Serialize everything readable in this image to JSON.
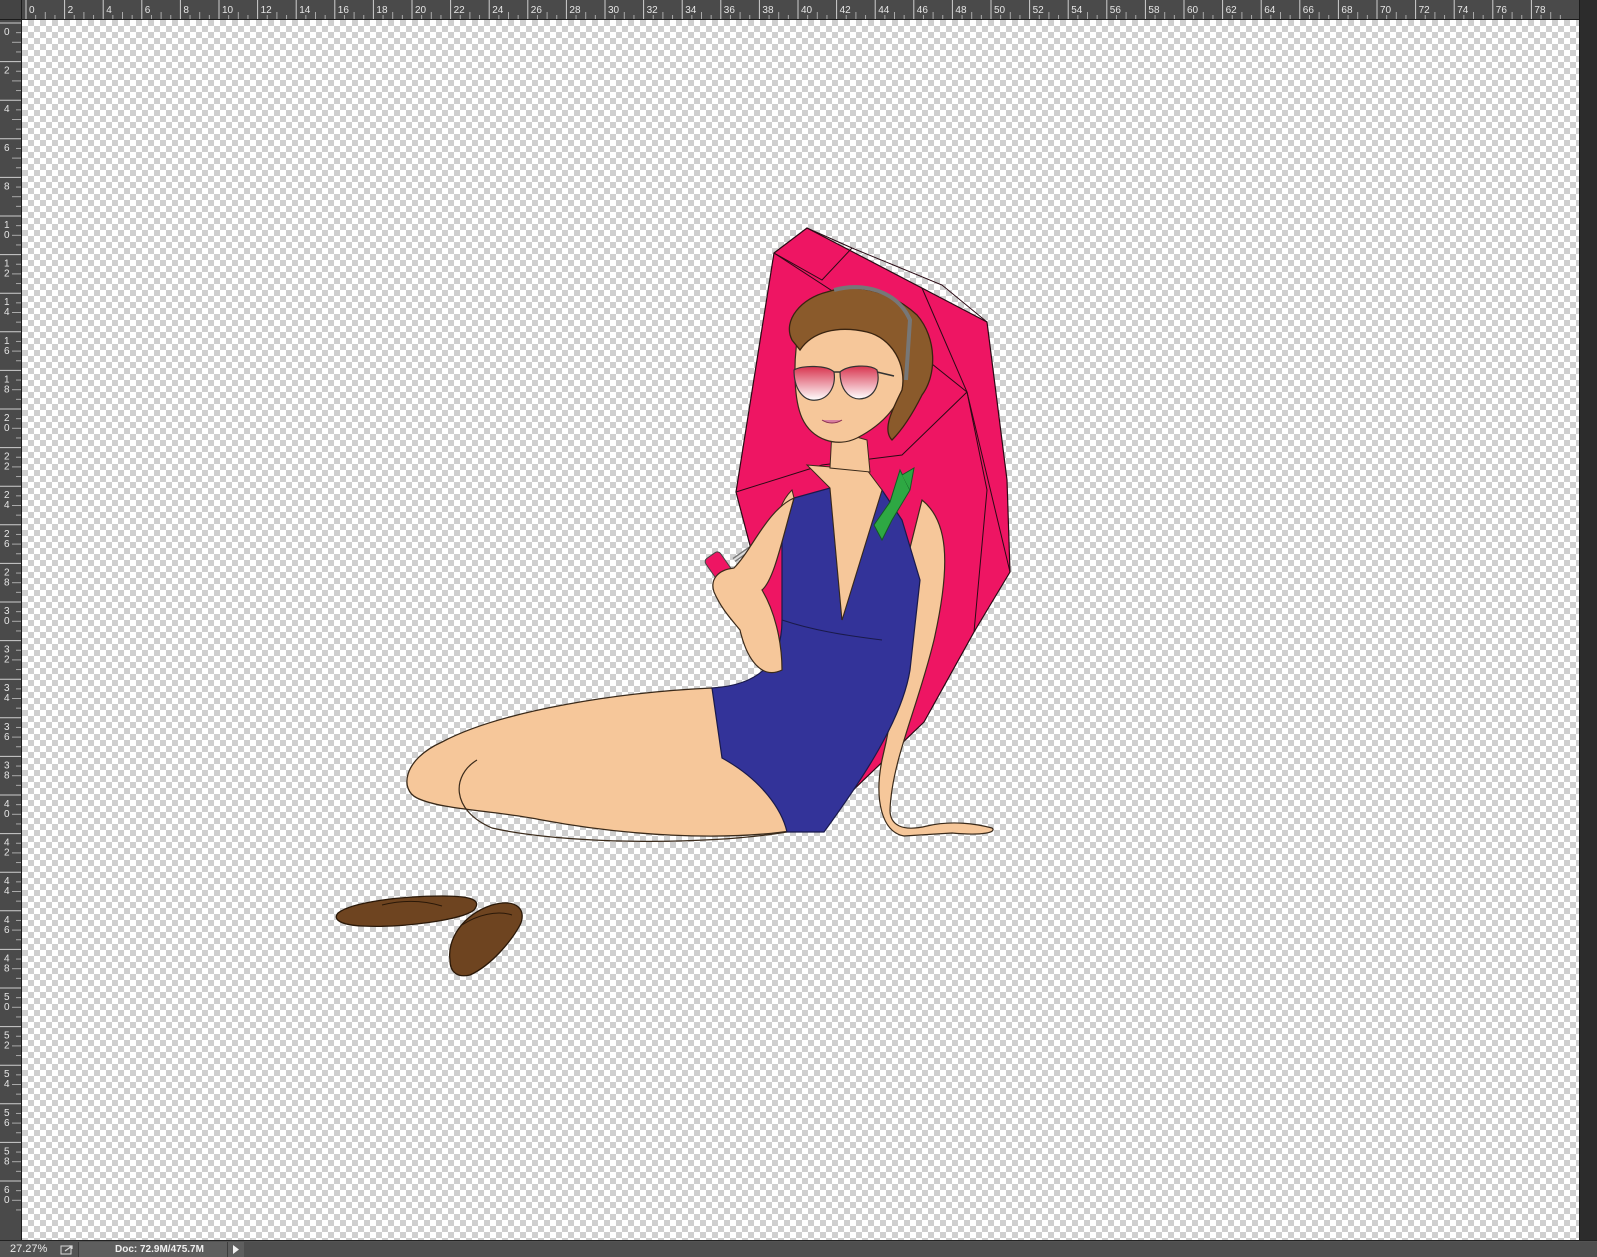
{
  "rulers": {
    "top_labels": [
      "0",
      "2",
      "4",
      "6",
      "8",
      "10",
      "12",
      "14",
      "16",
      "18",
      "20",
      "22",
      "24",
      "26",
      "28",
      "30",
      "32",
      "34",
      "36",
      "38",
      "40",
      "42",
      "44",
      "46",
      "48",
      "50",
      "52",
      "54",
      "56",
      "58",
      "60",
      "62",
      "64",
      "66",
      "68",
      "70",
      "72",
      "74",
      "76",
      "78"
    ],
    "left_labels": [
      "0",
      "2",
      "4",
      "6",
      "8",
      "10",
      "12",
      "14",
      "16",
      "18",
      "20",
      "22",
      "24",
      "26",
      "28",
      "30",
      "32",
      "34",
      "36",
      "38",
      "40",
      "42",
      "44",
      "46",
      "48",
      "50",
      "52",
      "54",
      "56",
      "58",
      "60"
    ]
  },
  "status": {
    "zoom": "27.27%",
    "doc_info": "Doc: 72.9M/475.7M"
  },
  "colors": {
    "umbrella": "#ee1563",
    "swimsuit": "#333399",
    "skin": "#f6c79a",
    "hair": "#8a5a2b",
    "sandals": "#6e4420",
    "ribbon": "#2ea843"
  },
  "icons": {
    "export": "share-arrow-icon",
    "menu": "triangle-right-icon"
  }
}
